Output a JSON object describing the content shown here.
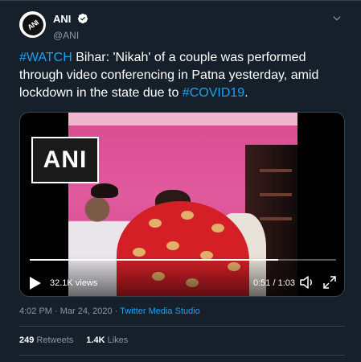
{
  "account": {
    "display_name": "ANI",
    "handle": "@ANI",
    "avatar_text": "ANI"
  },
  "tweet": {
    "hashtag_1": "#WATCH",
    "text_1": " Bihar: 'Nikah' of a couple was performed through video conferencing in Patna yesterday, amid lockdown in the state due to ",
    "hashtag_2": "#COVID19",
    "text_2": "."
  },
  "video": {
    "watermark": "ANI",
    "views": "32.1K views",
    "time": "0:51 / 1:03",
    "progress": 0.81
  },
  "meta": {
    "timestamp": "4:02 PM · Mar 24, 2020 · ",
    "source": "Twitter Media Studio"
  },
  "stats": {
    "retweets_count": "249",
    "retweets_label": "Retweets",
    "likes_count": "1.4K",
    "likes_label": "Likes"
  },
  "colors": {
    "background": "#15202b",
    "link": "#1da1f2",
    "secondary_text": "#8899a6",
    "border": "#38444d"
  }
}
